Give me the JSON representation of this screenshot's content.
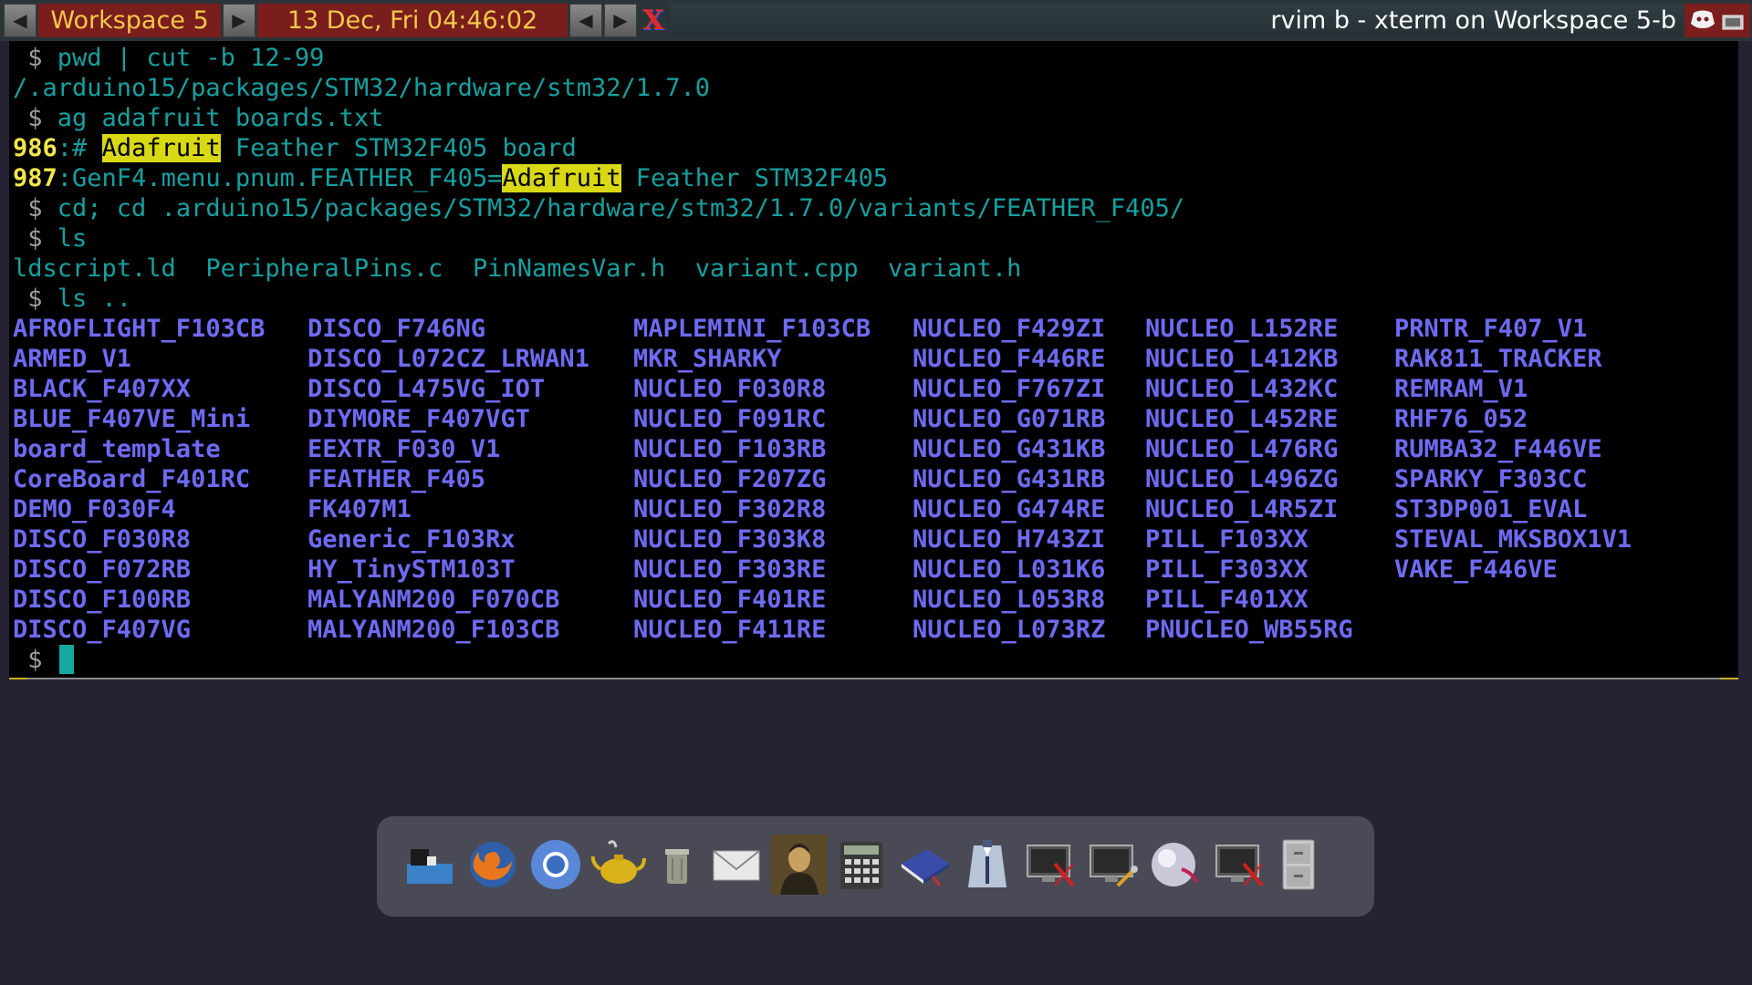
{
  "topbar": {
    "workspace": "Workspace 5",
    "clock": "13 Dec, Fri 04:46:02",
    "window_title": "rvim b - xterm on Workspace 5-b",
    "prev_arrow": "◀",
    "next_arrow": "▶"
  },
  "terminal": {
    "prompt": " $ ",
    "cmd1": "pwd | cut -b 12-99",
    "out1": "/.arduino15/packages/STM32/hardware/stm32/1.7.0",
    "cmd2": "ag adafruit boards.txt",
    "match1": {
      "line": "986",
      "pre": ":# ",
      "hit": "Adafruit",
      "post": " Feather STM32F405 board"
    },
    "match2": {
      "line": "987",
      "pre": ":GenF4.menu.pnum.FEATHER_F405=",
      "hit": "Adafruit",
      "post": " Feather STM32F405"
    },
    "cmd3": "cd; cd .arduino15/packages/STM32/hardware/stm32/1.7.0/variants/FEATHER_F405/",
    "cmd4": "ls",
    "files": [
      "ldscript.ld",
      "PeripheralPins.c",
      "PinNamesVar.h",
      "variant.cpp",
      "variant.h"
    ],
    "cmd5": "ls ..",
    "dirs_columns": [
      [
        "AFROFLIGHT_F103CB",
        "ARMED_V1",
        "BLACK_F407XX",
        "BLUE_F407VE_Mini",
        "board_template",
        "CoreBoard_F401RC",
        "DEMO_F030F4",
        "DISCO_F030R8",
        "DISCO_F072RB",
        "DISCO_F100RB",
        "DISCO_F407VG"
      ],
      [
        "DISCO_F746NG",
        "DISCO_L072CZ_LRWAN1",
        "DISCO_L475VG_IOT",
        "DIYMORE_F407VGT",
        "EEXTR_F030_V1",
        "FEATHER_F405",
        "FK407M1",
        "Generic_F103Rx",
        "HY_TinySTM103T",
        "MALYANM200_F070CB",
        "MALYANM200_F103CB"
      ],
      [
        "MAPLEMINI_F103CB",
        "MKR_SHARKY",
        "NUCLEO_F030R8",
        "NUCLEO_F091RC",
        "NUCLEO_F103RB",
        "NUCLEO_F207ZG",
        "NUCLEO_F302R8",
        "NUCLEO_F303K8",
        "NUCLEO_F303RE",
        "NUCLEO_F401RE",
        "NUCLEO_F411RE"
      ],
      [
        "NUCLEO_F429ZI",
        "NUCLEO_F446RE",
        "NUCLEO_F767ZI",
        "NUCLEO_G071RB",
        "NUCLEO_G431KB",
        "NUCLEO_G431RB",
        "NUCLEO_G474RE",
        "NUCLEO_H743ZI",
        "NUCLEO_L031K6",
        "NUCLEO_L053R8",
        "NUCLEO_L073RZ"
      ],
      [
        "NUCLEO_L152RE",
        "NUCLEO_L412KB",
        "NUCLEO_L432KC",
        "NUCLEO_L452RE",
        "NUCLEO_L476RG",
        "NUCLEO_L496ZG",
        "NUCLEO_L4R5ZI",
        "PILL_F103XX",
        "PILL_F303XX",
        "PILL_F401XX",
        "PNUCLEO_WB55RG"
      ],
      [
        "PRNTR_F407_V1",
        "RAK811_TRACKER",
        "REMRAM_V1",
        "RHF76_052",
        "RUMBA32_F446VE",
        "SPARKY_F303CC",
        "ST3DP001_EVAL",
        "STEVAL_MKSBOX1V1",
        "VAKE_F446VE"
      ]
    ],
    "final_prompt": " $ "
  },
  "dock": {
    "items": [
      "dock-app-icon",
      "firefox-icon",
      "chromium-icon",
      "teapot-icon",
      "trash-icon",
      "mail-icon",
      "mona-lisa-icon",
      "calculator-icon",
      "book-icon",
      "suit-icon",
      "monitor-off-icon",
      "monitor-tools-icon",
      "sphere-icon",
      "monitor-off-2-icon",
      "file-cabinet-icon"
    ]
  },
  "colors": {
    "panel_red": "#7a1d1d",
    "panel_text": "#f2c84a",
    "term_cyan": "#17a0a0",
    "dir_blue": "#6f6af2",
    "highlight": "#d8d814",
    "desktop": "#252333"
  }
}
